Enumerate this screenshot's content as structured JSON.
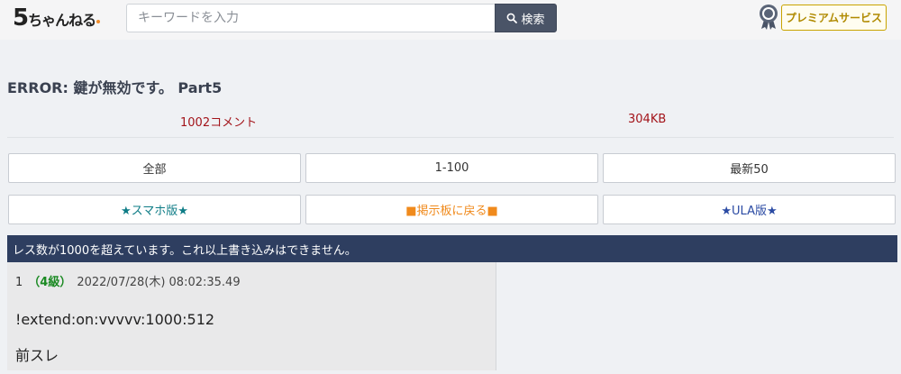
{
  "header": {
    "logo_num": "5",
    "logo_text": "ちゃんねる",
    "search_placeholder": "キーワードを入力",
    "search_button_label": "検索",
    "premium_label": "プレミアムサービス"
  },
  "thread": {
    "title": "ERROR: 鍵が無効です。 Part5",
    "comments": "1002コメント",
    "size": "304KB"
  },
  "nav": {
    "row1": [
      "全部",
      "1-100",
      "最新50"
    ],
    "row2": [
      "★スマホ版★",
      "■掲示板に戻る■",
      "★ULA版★"
    ]
  },
  "notice": "レス数が1000を超えています。これ以上書き込みはできません。",
  "post": {
    "number": "1",
    "level": "（4級）",
    "date": "2022/07/28(木) 08:02:35.49",
    "body_lines": [
      "!extend:on:vvvvv:1000:512",
      "前スレ"
    ]
  },
  "colors": {
    "notice_bg": "#2e3e60",
    "search_button_bg": "#4a5467",
    "meta_red": "#a3141a",
    "level_green": "#1b8a23",
    "premium_gold": "#c9a400"
  }
}
